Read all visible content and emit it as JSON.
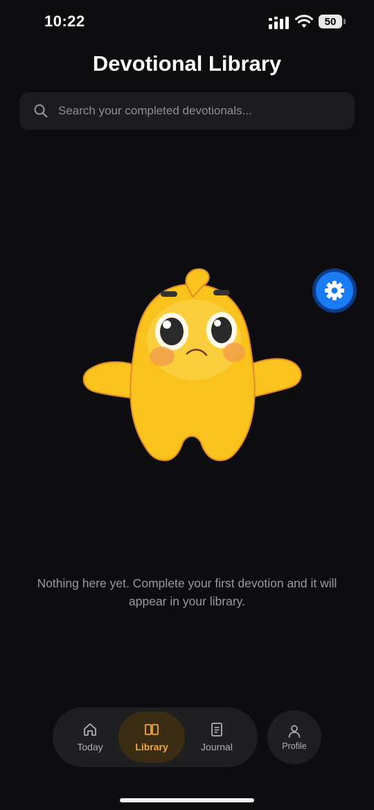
{
  "status_bar": {
    "time": "10:22",
    "battery_level": "50",
    "icons": [
      "signal-icon",
      "wifi-icon",
      "battery-icon"
    ]
  },
  "header": {
    "title": "Devotional Library"
  },
  "search": {
    "placeholder": "Search your completed devotionals...",
    "value": "",
    "icon": "search-icon"
  },
  "empty_state": {
    "illustration": "shrugging-mascot",
    "message": "Nothing here yet. Complete your first devotion and it will appear in your library."
  },
  "settings_button": {
    "icon": "gear-icon"
  },
  "tab_bar": {
    "tabs": [
      {
        "label": "Today",
        "icon": "home-icon",
        "active": false
      },
      {
        "label": "Library",
        "icon": "book-icon",
        "active": true
      },
      {
        "label": "Journal",
        "icon": "document-icon",
        "active": false
      }
    ],
    "profile": {
      "label": "Profile",
      "icon": "person-icon"
    }
  },
  "colors": {
    "background": "#0d0d0f",
    "accent": "#f3a63b",
    "fab_blue": "#1a7cf5",
    "mascot_yellow": "#f9c21c"
  }
}
